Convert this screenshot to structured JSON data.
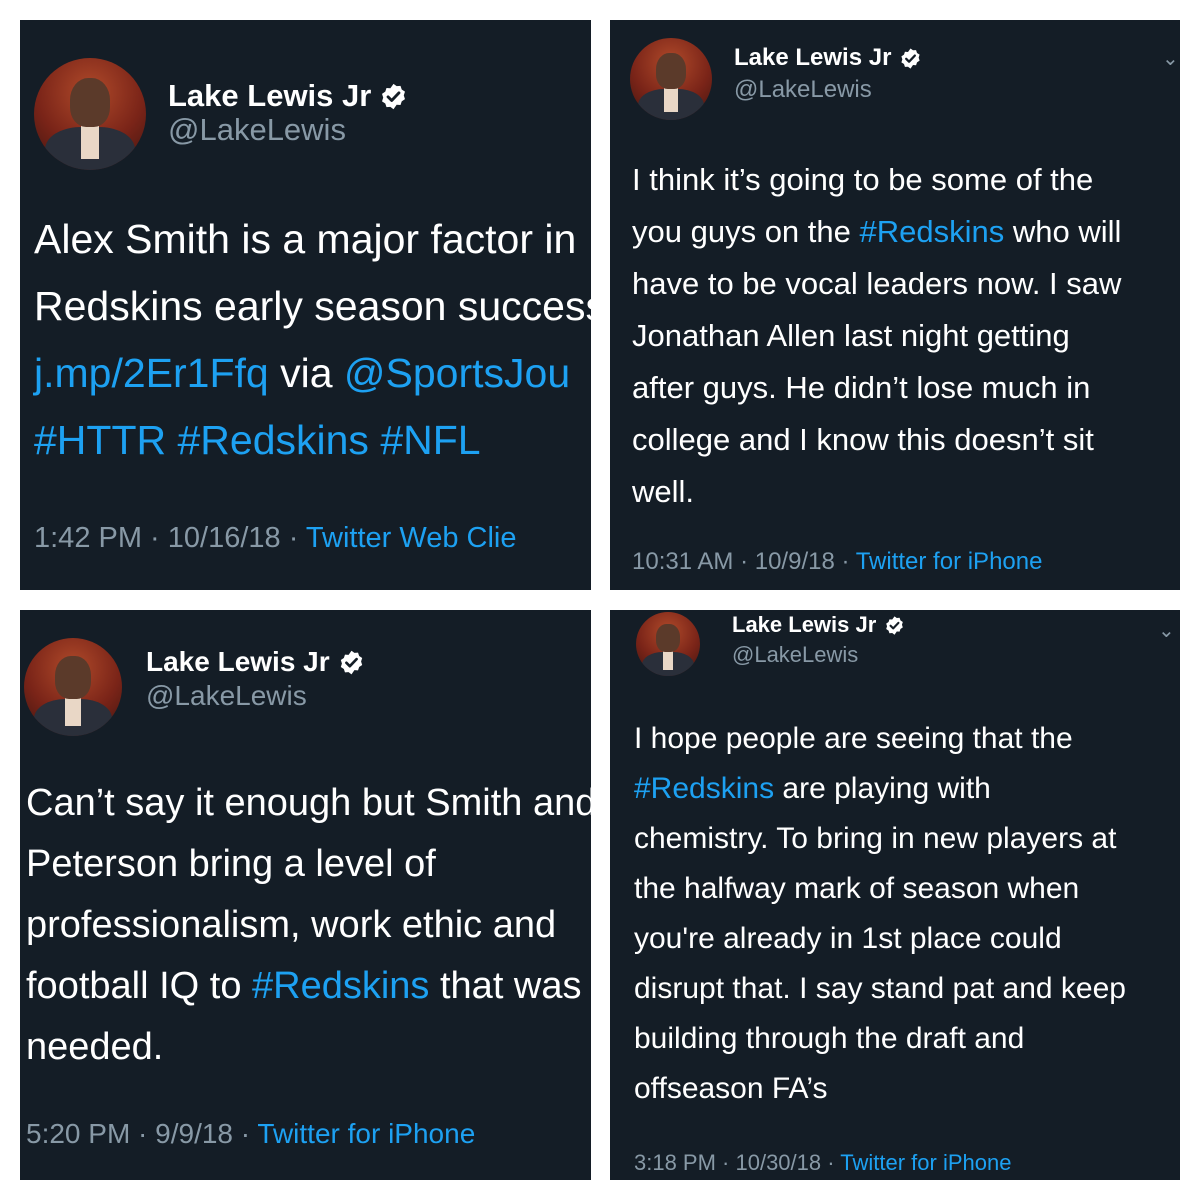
{
  "colors": {
    "panel_bg": "#141d26",
    "text": "#ffffff",
    "secondary": "#8899a6",
    "link": "#1da1f2",
    "verified": "#ffffff"
  },
  "icons": {
    "verified": "verified-badge-icon",
    "chevron": "chevron-down-icon"
  },
  "tweets": [
    {
      "name": "Lake Lewis Jr",
      "handle": "@LakeLewis",
      "lines": [
        [
          {
            "t": "Alex Smith is a major factor in"
          }
        ],
        [
          {
            "t": "Redskins early season success"
          }
        ],
        [
          {
            "t": "j.mp/2Er1Ffq",
            "link": true
          },
          {
            "t": " via "
          },
          {
            "t": "@SportsJou",
            "link": true
          }
        ],
        [
          {
            "t": "#HTTR #Redskins #NFL",
            "link": true
          }
        ]
      ],
      "time": "1:42 PM · 10/16/18 · ",
      "source": "Twitter Web Clie"
    },
    {
      "name": "Lake Lewis Jr",
      "handle": "@LakeLewis",
      "chevron": "⌄",
      "lines": [
        [
          {
            "t": "I think it’s going to be some of the"
          }
        ],
        [
          {
            "t": "you guys on the "
          },
          {
            "t": "#Redskins",
            "link": true
          },
          {
            "t": " who will"
          }
        ],
        [
          {
            "t": "have to be vocal leaders now. I saw"
          }
        ],
        [
          {
            "t": "Jonathan Allen last night getting"
          }
        ],
        [
          {
            "t": "after guys. He didn’t lose much in"
          }
        ],
        [
          {
            "t": "college and I know this doesn’t sit"
          }
        ],
        [
          {
            "t": "well."
          }
        ]
      ],
      "time": "10:31 AM · 10/9/18 · ",
      "source": "Twitter for iPhone"
    },
    {
      "name": "Lake Lewis Jr",
      "handle": "@LakeLewis",
      "lines": [
        [
          {
            "t": "Can’t say it enough but Smith and"
          }
        ],
        [
          {
            "t": "Peterson bring a level of"
          }
        ],
        [
          {
            "t": "professionalism, work ethic and"
          }
        ],
        [
          {
            "t": "football IQ to "
          },
          {
            "t": "#Redskins",
            "link": true
          },
          {
            "t": " that was"
          }
        ],
        [
          {
            "t": "needed."
          }
        ]
      ],
      "time": "5:20 PM · 9/9/18 · ",
      "source": "Twitter for iPhone"
    },
    {
      "name": "Lake Lewis Jr",
      "handle": "@LakeLewis",
      "chevron": "⌄",
      "lines": [
        [
          {
            "t": "I hope people are seeing that the"
          }
        ],
        [
          {
            "t": "#Redskins",
            "link": true
          },
          {
            "t": " are playing with"
          }
        ],
        [
          {
            "t": "chemistry. To bring in new players at"
          }
        ],
        [
          {
            "t": "the halfway mark of season when"
          }
        ],
        [
          {
            "t": "you're already in 1st place could"
          }
        ],
        [
          {
            "t": "disrupt that. I say stand pat and keep"
          }
        ],
        [
          {
            "t": "building through the draft and"
          }
        ],
        [
          {
            "t": "offseason FA’s"
          }
        ]
      ],
      "time": "3:18 PM · 10/30/18 · ",
      "source": "Twitter for iPhone"
    }
  ]
}
